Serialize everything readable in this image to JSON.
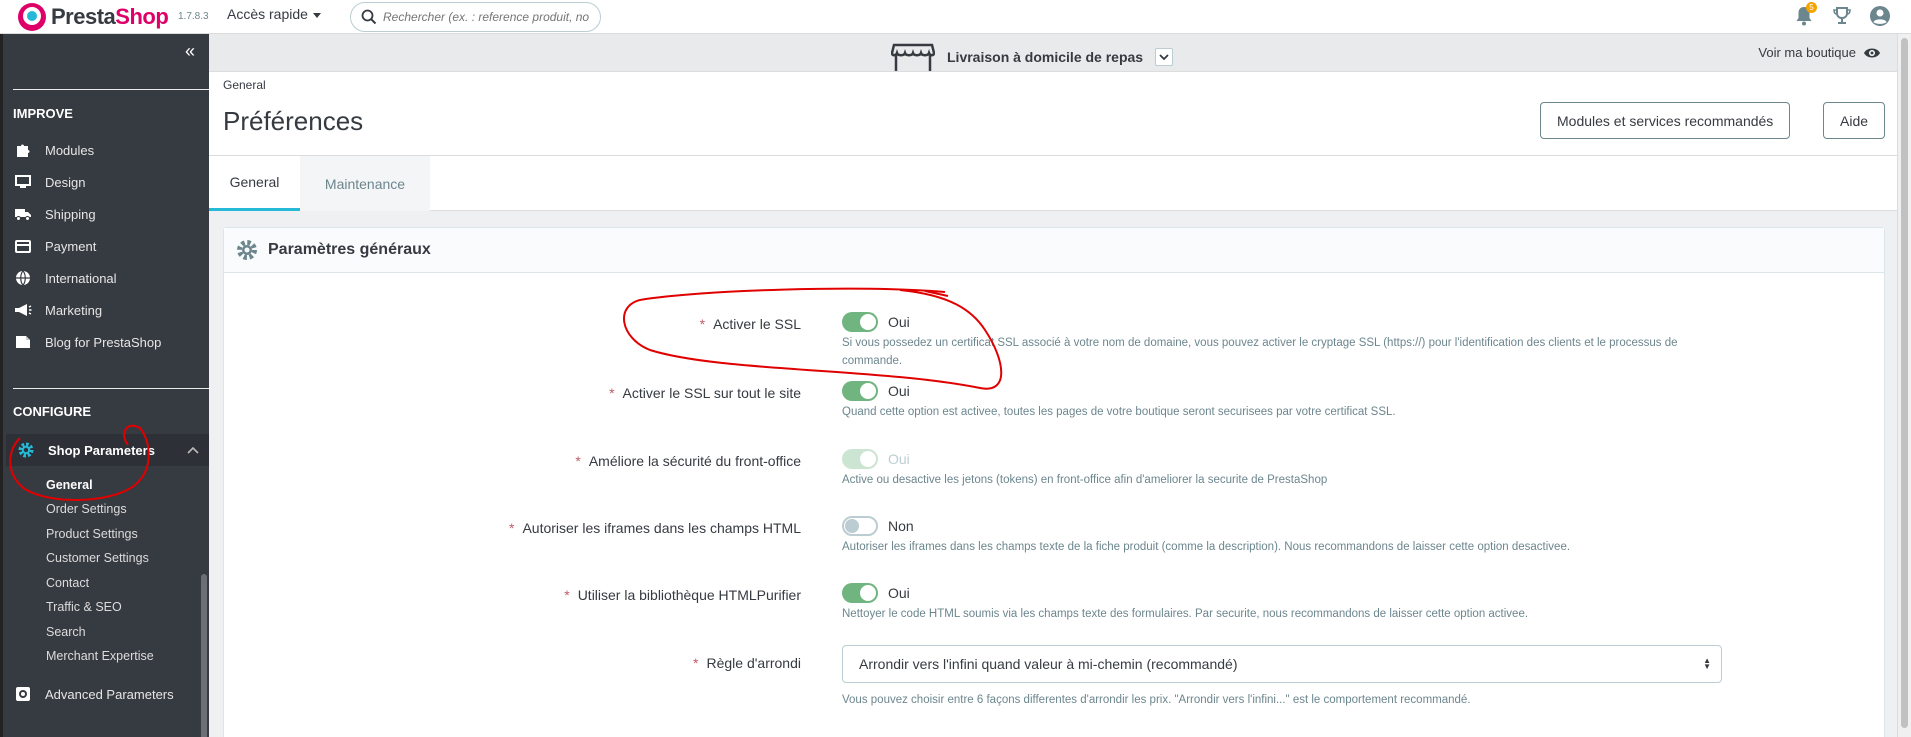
{
  "topbar": {
    "logo_text_a": "Presta",
    "logo_text_b": "Shop",
    "version": "1.7.8.3",
    "quick_access": "Accès rapide",
    "search_placeholder": "Rechercher (ex. : reference produit, no",
    "notification_count": "5",
    "icons": [
      "bell-icon",
      "trophy-icon",
      "user-icon"
    ]
  },
  "store": {
    "name": "Livraison à domicile de repas",
    "view_shop": "Voir ma boutique"
  },
  "sidebar": {
    "improve_title": "IMPROVE",
    "improve_items": [
      {
        "label": "Modules",
        "icon": "puzzle-icon"
      },
      {
        "label": "Design",
        "icon": "monitor-icon"
      },
      {
        "label": "Shipping",
        "icon": "truck-icon"
      },
      {
        "label": "Payment",
        "icon": "credit-card-icon"
      },
      {
        "label": "International",
        "icon": "globe-icon"
      },
      {
        "label": "Marketing",
        "icon": "megaphone-icon"
      },
      {
        "label": "Blog for PrestaShop",
        "icon": "blog-icon"
      }
    ],
    "configure_title": "CONFIGURE",
    "shop_parameters": "Shop Parameters",
    "sub_items": [
      "General",
      "Order Settings",
      "Product Settings",
      "Customer Settings",
      "Contact",
      "Traffic & SEO",
      "Search",
      "Merchant Expertise"
    ],
    "advanced_parameters": "Advanced Parameters"
  },
  "header": {
    "breadcrumb": "General",
    "title": "Préférences",
    "btn_modules": "Modules et services recommandés",
    "btn_help": "Aide"
  },
  "tabs": [
    "General",
    "Maintenance"
  ],
  "card": {
    "title": "Paramètres généraux",
    "rows": [
      {
        "label": "Activer le SSL",
        "value": "Oui",
        "help": "Si vous possedez un certificat SSL associé à votre nom de domaine, vous pouvez activer le cryptage SSL (https://) pour l'identification des clients et le processus de commande."
      },
      {
        "label": "Activer le SSL sur tout le site",
        "value": "Oui",
        "help": "Quand cette option est activee, toutes les pages de votre boutique seront securisees par votre certificat SSL."
      },
      {
        "label": "Améliore la sécurité du front-office",
        "value": "Oui",
        "help": "Active ou desactive les jetons (tokens) en front-office afin d'ameliorer la securite de PrestaShop"
      },
      {
        "label": "Autoriser les iframes dans les champs HTML",
        "value": "Non",
        "help": "Autoriser les iframes dans les champs texte de la fiche produit (comme la description). Nous recommandons de laisser cette option desactivee."
      },
      {
        "label": "Utiliser la bibliothèque HTMLPurifier",
        "value": "Oui",
        "help": "Nettoyer le code HTML soumis via les champs texte des formulaires. Par securite, nous recommandons de laisser cette option activee."
      },
      {
        "label": "Règle d'arrondi",
        "value": "Arrondir vers l'infini quand valeur à mi-chemin (recommandé)",
        "help": "Vous pouvez choisir entre 6 façons differentes d'arrondir les prix. \"Arrondir vers l'infini...\" est le comportement recommandé."
      }
    ]
  },
  "colors": {
    "sidebar": "#363a41",
    "accent": "#25b9d7",
    "switch_on": "#70b580",
    "annotation": "#e00000"
  }
}
